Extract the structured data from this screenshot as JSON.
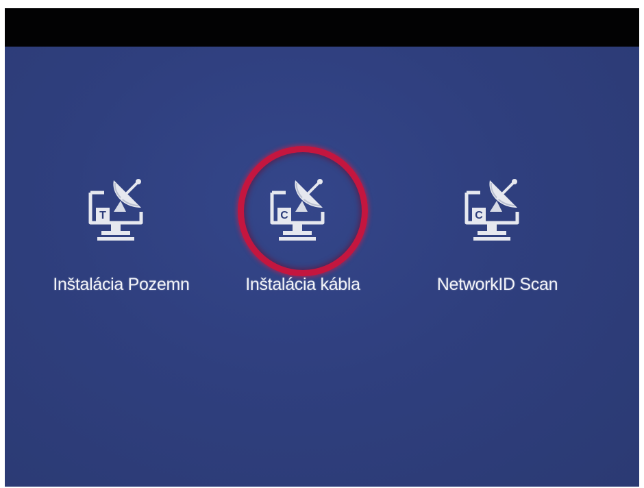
{
  "menu": {
    "items": [
      {
        "label": "Inštalácia Pozemn",
        "badge": "T",
        "icon": "satellite-dish-monitor-icon",
        "selected": false
      },
      {
        "label": "Inštalácia kábla",
        "badge": "C",
        "icon": "satellite-dish-monitor-icon",
        "selected": true
      },
      {
        "label": "NetworkID Scan",
        "badge": "C",
        "icon": "satellite-dish-monitor-icon",
        "selected": false
      }
    ]
  },
  "colors": {
    "background": "#2d3d7a",
    "top_bar": "#020203",
    "selection_ring": "#c4163f",
    "label": "#f2f3f8",
    "icon": "#e6e8ef"
  }
}
